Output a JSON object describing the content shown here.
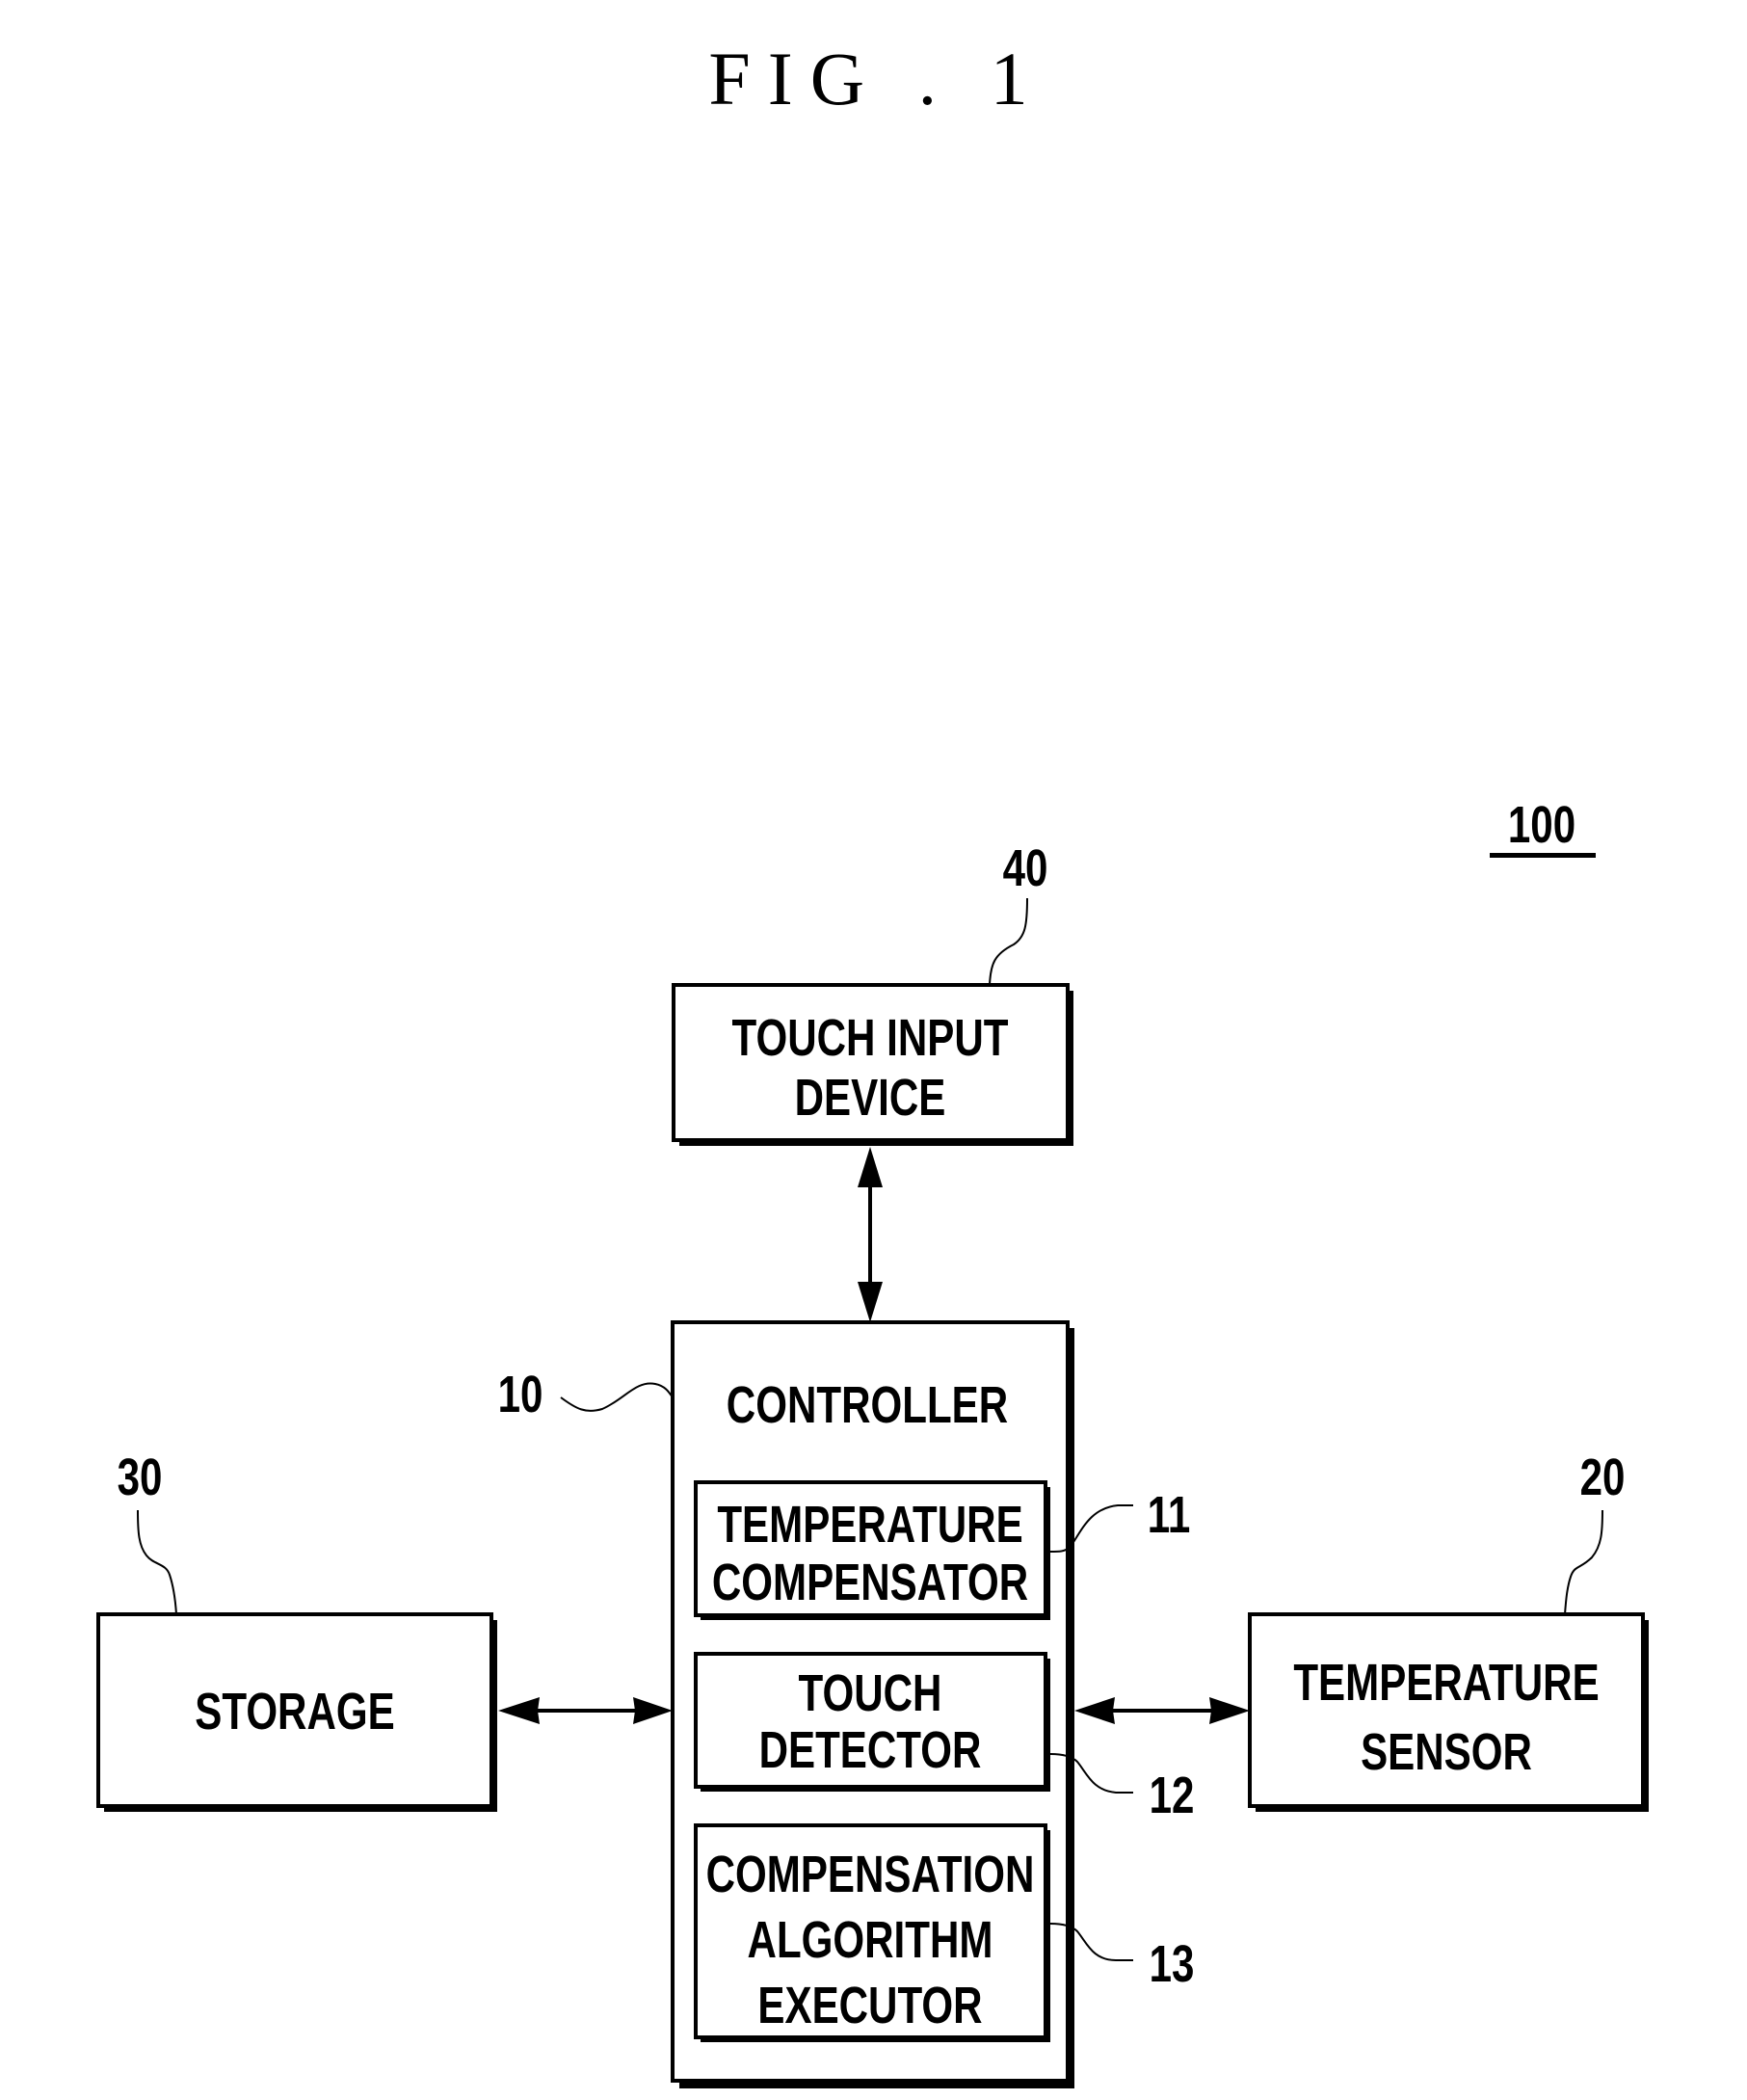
{
  "figure": {
    "title": "FIG . 1",
    "system_ref": "100"
  },
  "blocks": {
    "touch_input_device": {
      "ref": "40",
      "lines": [
        "TOUCH INPUT",
        "DEVICE"
      ]
    },
    "controller": {
      "ref": "10",
      "lines": [
        "CONTROLLER"
      ]
    },
    "temperature_compensator": {
      "ref": "11",
      "lines": [
        "TEMPERATURE",
        "COMPENSATOR"
      ]
    },
    "touch_detector": {
      "ref": "12",
      "lines": [
        "TOUCH",
        "DETECTOR"
      ]
    },
    "compensation_algorithm_executor": {
      "ref": "13",
      "lines": [
        "COMPENSATION",
        "ALGORITHM",
        "EXECUTOR"
      ]
    },
    "storage": {
      "ref": "30",
      "lines": [
        "STORAGE"
      ]
    },
    "temperature_sensor": {
      "ref": "20",
      "lines": [
        "TEMPERATURE",
        "SENSOR"
      ]
    }
  },
  "connections": [
    {
      "from": "touch_input_device",
      "to": "controller",
      "type": "bidirectional"
    },
    {
      "from": "storage",
      "to": "controller",
      "type": "bidirectional"
    },
    {
      "from": "temperature_sensor",
      "to": "controller",
      "type": "bidirectional"
    }
  ]
}
